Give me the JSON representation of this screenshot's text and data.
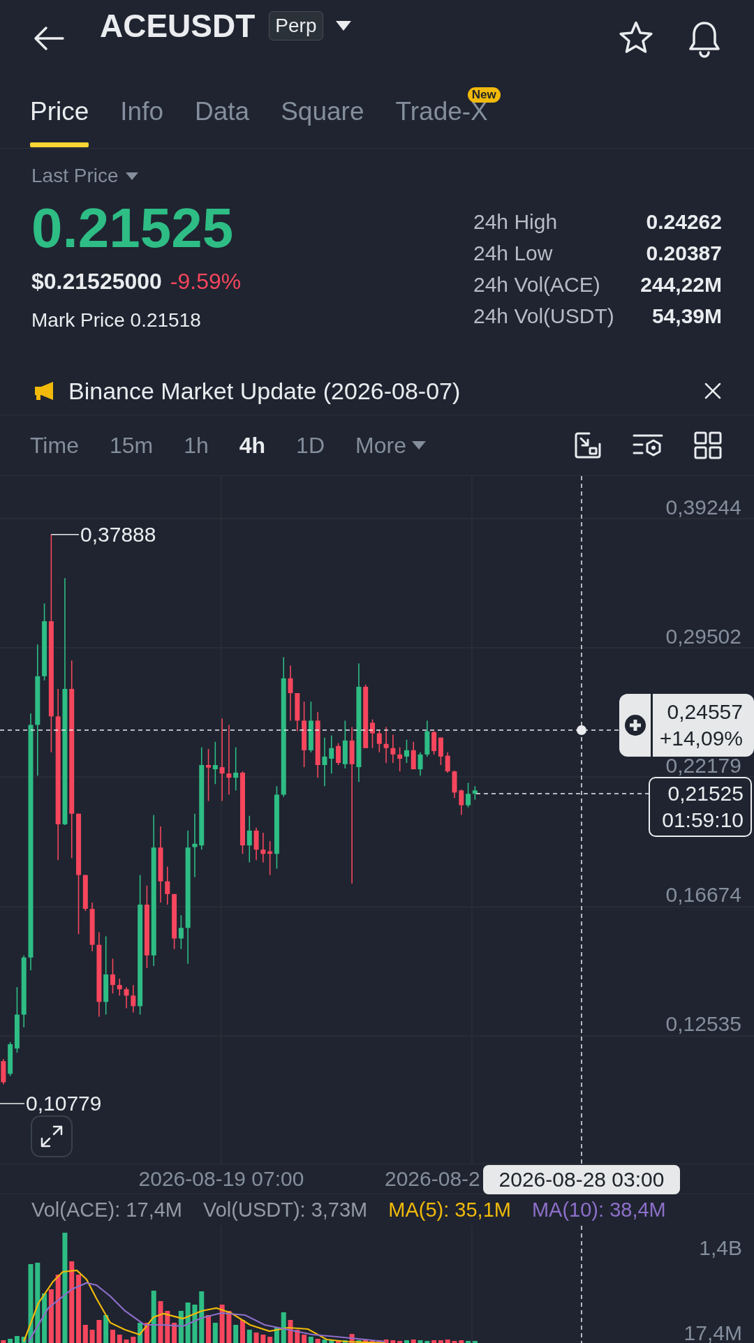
{
  "header": {
    "title": "ACEUSDT",
    "contract_type": "Perp"
  },
  "tabs": [
    {
      "label": "Price",
      "selected": true
    },
    {
      "label": "Info",
      "selected": false
    },
    {
      "label": "Data",
      "selected": false
    },
    {
      "label": "Square",
      "selected": false
    },
    {
      "label": "Trade-X",
      "selected": false,
      "badge": "New"
    }
  ],
  "price_panel": {
    "price_type": "Last Price",
    "last_price": "0.21525",
    "last_price_up": true,
    "usd_price": "$0.21525000",
    "change": "-9.59%",
    "change_up": false,
    "mark_price": "Mark Price 0.21518",
    "stats": [
      {
        "label": "24h High",
        "value": "0.24262"
      },
      {
        "label": "24h Low",
        "value": "0.20387"
      },
      {
        "label": "24h Vol(ACE)",
        "value": "244,22M"
      },
      {
        "label": "24h Vol(USDT)",
        "value": "54,39M"
      }
    ]
  },
  "announcement": {
    "text": "Binance Market Update (2026-08-07)"
  },
  "intervals": [
    {
      "label": "Time",
      "kind": "option",
      "selected": false
    },
    {
      "label": "15m",
      "kind": "option",
      "selected": false
    },
    {
      "label": "1h",
      "kind": "option",
      "selected": false
    },
    {
      "label": "4h",
      "kind": "option",
      "selected": true
    },
    {
      "label": "1D",
      "kind": "option",
      "selected": false
    },
    {
      "label": "More",
      "kind": "menu",
      "selected": false
    }
  ],
  "chart": {
    "y_axis_labels": [
      "0,39244",
      "0,29502",
      "0,22179",
      "0,16674",
      "0,12535"
    ],
    "high_label": "0,37888",
    "low_label": "0,10779",
    "crosshair": {
      "price": "0,24557",
      "change": "+14,09%",
      "time": "2026-08-28 03:00"
    },
    "last_price_tag": {
      "price": "0,21525",
      "countdown": "01:59:10"
    },
    "x_axis_labels": [
      "2026-08-19 07:00",
      "2026-08-2"
    ]
  },
  "volume": {
    "legend": [
      {
        "label": "Vol(ACE): 17,4M",
        "color": "#929aa5"
      },
      {
        "label": "Vol(USDT): 3,73M",
        "color": "#929aa5"
      },
      {
        "label": "MA(5): 35,1M",
        "color": "#f0b90b"
      },
      {
        "label": "MA(10): 38,4M",
        "color": "#8d6fc9"
      }
    ],
    "y_axis_labels": [
      "1,4B",
      "17,4M"
    ]
  }
}
